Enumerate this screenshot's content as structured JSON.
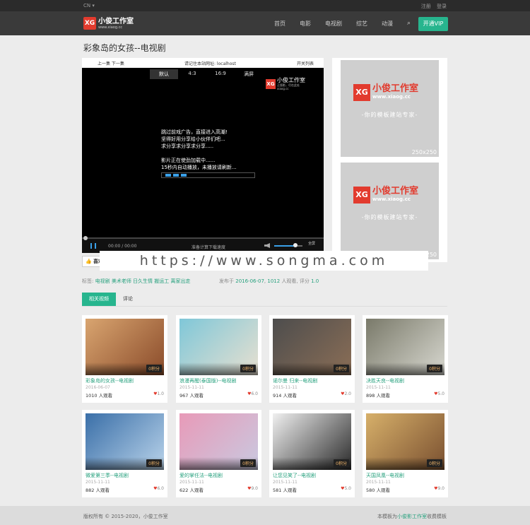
{
  "topbar": {
    "lang": "CN ▾",
    "register": "注册",
    "login": "登录"
  },
  "brand": {
    "mark": "XG",
    "name": "小俊工作室",
    "url": "www.xiaog.cc"
  },
  "nav": {
    "items": [
      "首页",
      "电影",
      "电视剧",
      "综艺",
      "动漫"
    ],
    "search_icon": "⌕",
    "vip_label": "开通VIP"
  },
  "page": {
    "title": "彩象岛的女孩--电视剧"
  },
  "player": {
    "prev_next": "上一集 下一集",
    "notice": "请记住本站网址: localhost",
    "playlist": "开关列表",
    "ratios": [
      "默认",
      "4:3",
      "16:9",
      "满屏"
    ],
    "logo_name": "小俊工作室",
    "logo_sub": "正版影，尽在此处",
    "logo_url": "xiaog.cc",
    "messages": [
      "跳过前戏广告，直接进入高潮!",
      "坚得好用分享给小伙伴们吧...",
      "求分享求分享求分享.....",
      "",
      "影片正在使劲加载中......",
      "15秒内自动播放，未播放请刷新..."
    ],
    "time": "00:00  /  00:00",
    "next_hint": "准备计算下载速度",
    "fullscreen": "全屏",
    "progress": 0.0,
    "volume": 0.75
  },
  "ads": [
    {
      "mark": "XG",
      "name": "小俊工作室",
      "url": "www.xiaog.cc",
      "slogan": "-你的模板建站专家-",
      "dims": "250x250"
    },
    {
      "mark": "XG",
      "name": "小俊工作室",
      "url": "www.xiaog.cc",
      "slogan": "-你的模板建站专家-",
      "dims": "250x250"
    }
  ],
  "share": {
    "like": "👍",
    "text": "喜欢"
  },
  "watermark": "https://www.songma.com",
  "tags": {
    "label": "标签:",
    "values": "电视剧 美术老师 日久生情 搬运工 离家出走"
  },
  "meta": {
    "prefix": "发布于",
    "date": "2016-06-07",
    "views": "1012",
    "mid": "人观看, 评分",
    "score": "1.0"
  },
  "tabs": [
    "相关视频",
    "评论"
  ],
  "cards": [
    {
      "title": "彩象岛的女孩--电视剧",
      "date": "2016-06-07",
      "views": "1010 人观看",
      "score": "1.0",
      "badge": "0积分",
      "c1": "#d9a570",
      "c2": "#8a4b2a"
    },
    {
      "title": "浪漫再醒(泰国版)--电视剧",
      "date": "2015-11-11",
      "views": "967 人观看",
      "score": "6.0",
      "badge": "0积分",
      "c1": "#7fc7d8",
      "c2": "#e8e0d0"
    },
    {
      "title": "诺尔曼 归来--电视剧",
      "date": "2015-11-11",
      "views": "914 人观看",
      "score": "2.0",
      "badge": "0积分",
      "c1": "#4d4d4d",
      "c2": "#8b6e56"
    },
    {
      "title": "决胜天良--电视剧",
      "date": "2015-11-11",
      "views": "898 人观看",
      "score": "5.0",
      "badge": "0积分",
      "c1": "#7a7a6a",
      "c2": "#d8d8d0"
    },
    {
      "title": "微爱第三季--电视剧",
      "date": "2015-11-11",
      "views": "882 人观看",
      "score": "6.0",
      "badge": "0积分",
      "c1": "#3a6fa8",
      "c2": "#b9d3ea"
    },
    {
      "title": "爱的掌任法--电视剧",
      "date": "2015-11-11",
      "views": "622 人观看",
      "score": "9.0",
      "badge": "0积分",
      "c1": "#e89ab8",
      "c2": "#c9c9e0"
    },
    {
      "title": "让您见笑了--电视剧",
      "date": "2015-11-11",
      "views": "581 人观看",
      "score": "5.0",
      "badge": "0积分",
      "c1": "#f0f0f0",
      "c2": "#2a2a2a"
    },
    {
      "title": "天国凤凰--电视剧",
      "date": "2015-11-11",
      "views": "580 人观看",
      "score": "9.0",
      "badge": "0积分",
      "c1": "#d7b06a",
      "c2": "#7a5030"
    }
  ],
  "footer": {
    "copyright": "版权所有 © 2015-2020，小俊工作室",
    "tpl_prefix": "本模板为",
    "tpl_link": "小俊影工作室",
    "tpl_suffix": "收费模板"
  }
}
